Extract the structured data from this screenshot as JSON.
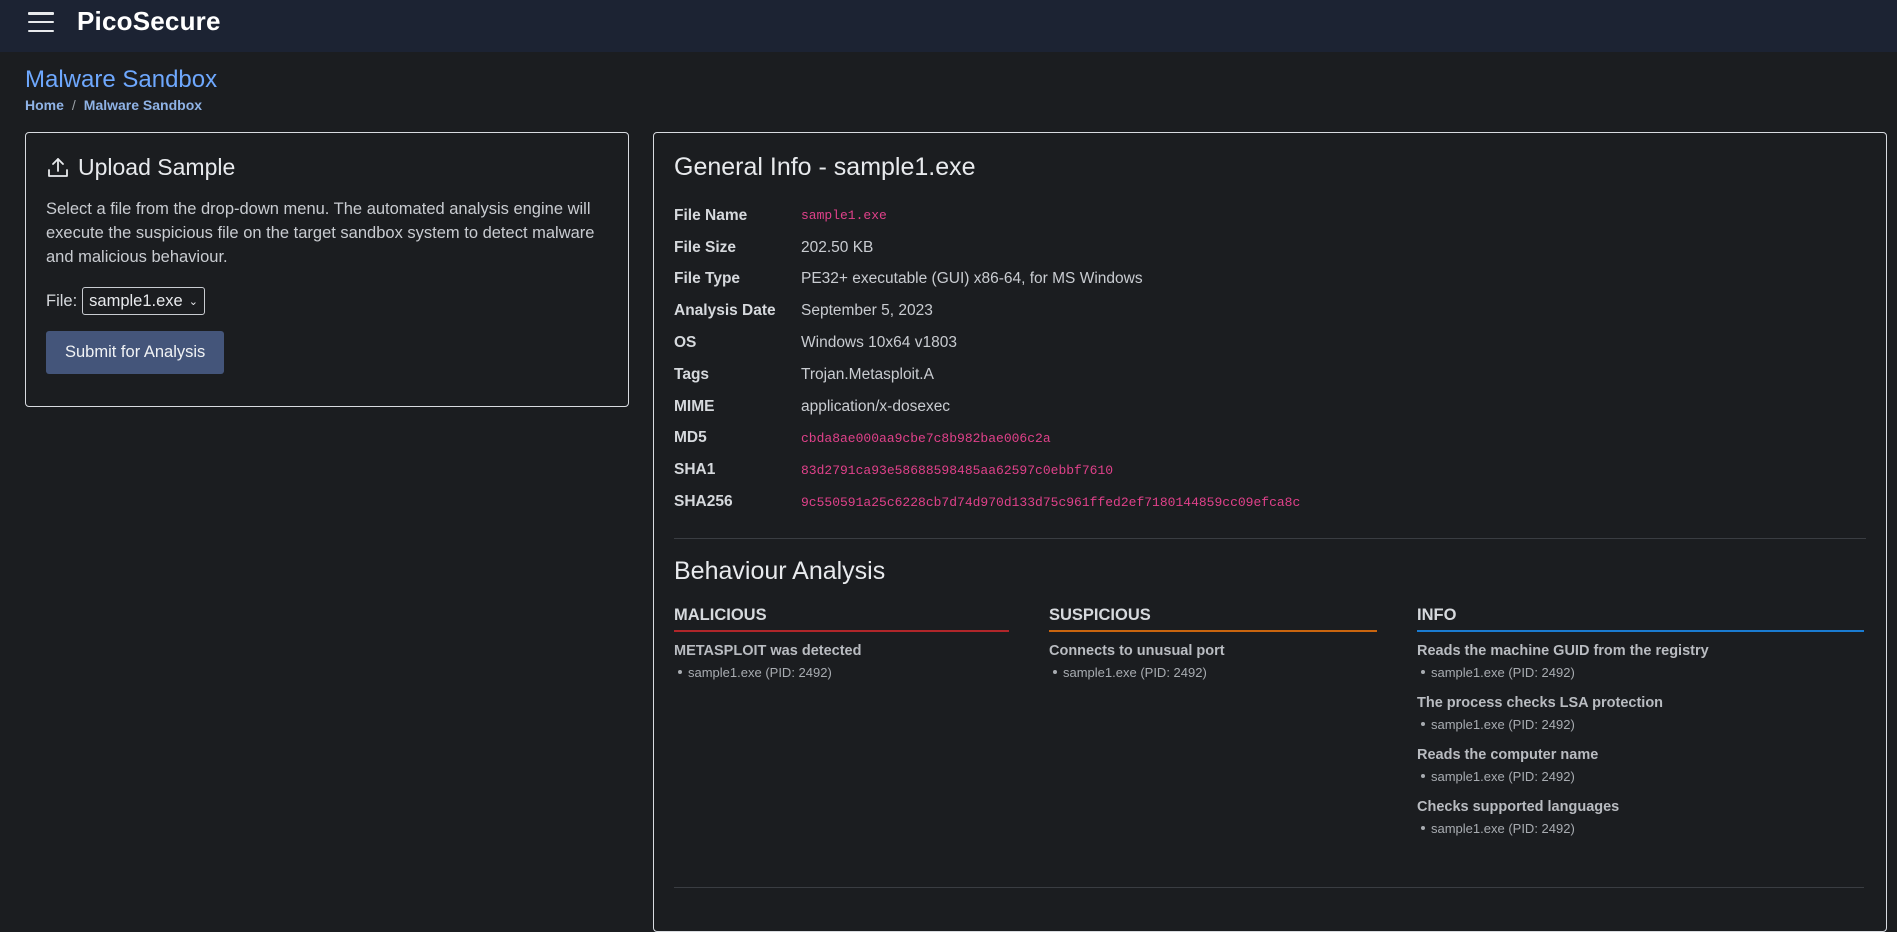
{
  "navbar": {
    "brand": "PicoSecure"
  },
  "page": {
    "title": "Malware Sandbox",
    "breadcrumb": {
      "home": "Home",
      "separator": "/",
      "current": "Malware Sandbox"
    }
  },
  "upload": {
    "title": "Upload Sample",
    "description": "Select a file from the drop-down menu. The automated analysis engine will execute the suspicious file on the target sandbox system to detect malware and malicious behaviour.",
    "file_label": "File:",
    "selected_file": "sample1.exe",
    "submit_label": "Submit for Analysis"
  },
  "general_info": {
    "title": "General Info - sample1.exe",
    "rows": [
      {
        "key": "File Name",
        "value": "sample1.exe"
      },
      {
        "key": "File Size",
        "value": "202.50 KB"
      },
      {
        "key": "File Type",
        "value": "PE32+ executable (GUI) x86-64, for MS Windows"
      },
      {
        "key": "Analysis Date",
        "value": "September 5, 2023"
      },
      {
        "key": "OS",
        "value": "Windows 10x64 v1803"
      },
      {
        "key": "Tags",
        "value": "Trojan.Metasploit.A"
      },
      {
        "key": "MIME",
        "value": "application/x-dosexec"
      },
      {
        "key": "MD5",
        "value": "cbda8ae000aa9cbe7c8b982bae006c2a"
      },
      {
        "key": "SHA1",
        "value": "83d2791ca93e58688598485aa62597c0ebbf7610"
      },
      {
        "key": "SHA256",
        "value": "9c550591a25c6228cb7d74d970d133d75c961ffed2ef7180144859cc09efca8c"
      }
    ]
  },
  "behaviour": {
    "title": "Behaviour Analysis",
    "malicious": {
      "heading": "MALICIOUS",
      "color": "#b0262a",
      "items": [
        {
          "title": "METASPLOIT was detected",
          "process": "sample1.exe (PID: 2492)"
        }
      ]
    },
    "suspicious": {
      "heading": "SUSPICIOUS",
      "color": "#c9650f",
      "items": [
        {
          "title": "Connects to unusual port",
          "process": "sample1.exe (PID: 2492)"
        }
      ]
    },
    "info": {
      "heading": "INFO",
      "color": "#1a7bd1",
      "items": [
        {
          "title": "Reads the machine GUID from the registry",
          "process": "sample1.exe (PID: 2492)"
        },
        {
          "title": "The process checks LSA protection",
          "process": "sample1.exe (PID: 2492)"
        },
        {
          "title": "Reads the computer name",
          "process": "sample1.exe (PID: 2492)"
        },
        {
          "title": "Checks supported languages",
          "process": "sample1.exe (PID: 2492)"
        }
      ]
    }
  }
}
